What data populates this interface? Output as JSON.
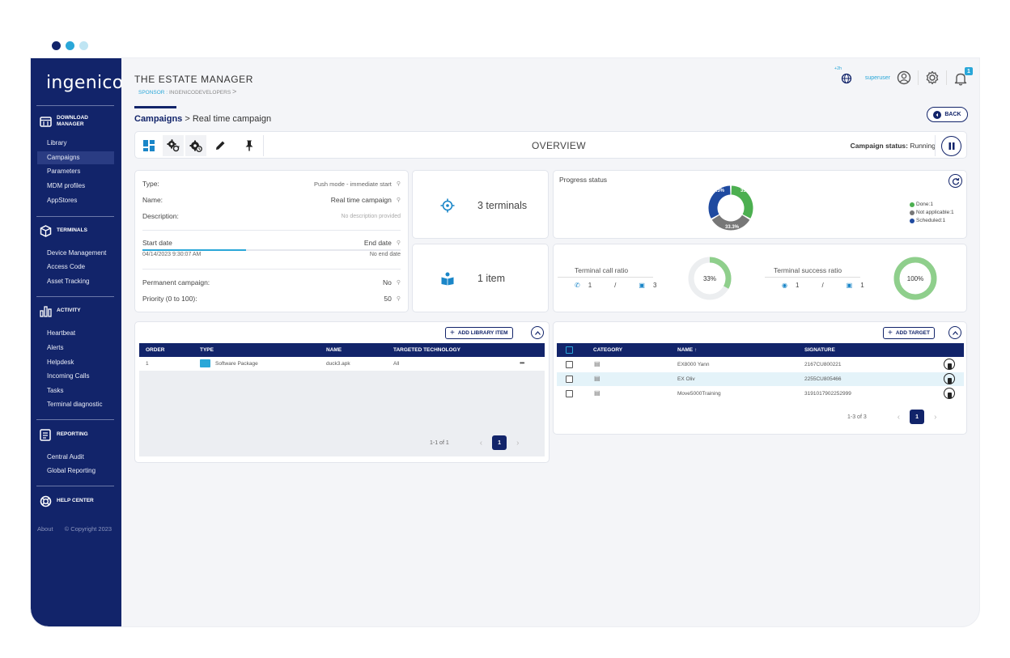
{
  "window": {
    "dots": [
      "#12246a",
      "#2aa7d8",
      "#bfe5f3"
    ]
  },
  "sidebar": {
    "logo": "ingenico",
    "sections": [
      {
        "title": "DOWNLOAD MANAGER",
        "icon": "download-manager-icon",
        "items": [
          "Library",
          "Campaigns",
          "Parameters",
          "MDM profiles",
          "AppStores"
        ],
        "active": "Campaigns"
      },
      {
        "title": "TERMINALS",
        "icon": "cube-icon",
        "items": [
          "Device Management",
          "Access Code",
          "Asset Tracking"
        ]
      },
      {
        "title": "ACTIVITY",
        "icon": "bar-chart-icon",
        "items": [
          "Heartbeat",
          "Alerts",
          "Helpdesk",
          "Incoming Calls",
          "Tasks",
          "Terminal diagnostic"
        ]
      },
      {
        "title": "REPORTING",
        "icon": "report-icon",
        "items": [
          "Central Audit",
          "Global Reporting"
        ]
      },
      {
        "title": "HELP CENTER",
        "icon": "lifebuoy-icon",
        "items": []
      }
    ],
    "footer": {
      "about": "About",
      "copyright": "© Copyright 2023"
    }
  },
  "header": {
    "title": "THE ESTATE MANAGER",
    "sponsor_label": "SPONSOR :",
    "sponsor_value": "INGENICODEVELOPERS",
    "sponsor_chevron": ">",
    "timezone": "+2h",
    "user": "superuser",
    "notification_count": "1"
  },
  "breadcrumb": {
    "root": "Campaigns",
    "sep": ">",
    "current": "Real time campaign"
  },
  "back_label": "BACK",
  "toolbar": {
    "overview": "OVERVIEW",
    "status_label": "Campaign status:",
    "status_value": "Running"
  },
  "details": {
    "type_label": "Type:",
    "type_value": "Push mode - immediate start",
    "name_label": "Name:",
    "name_value": "Real time campaign",
    "desc_label": "Description:",
    "desc_value": "No description provided",
    "start_label": "Start date",
    "start_value": "04/14/2023 9:30:07 AM",
    "end_label": "End date",
    "end_value": "No end date",
    "perm_label": "Permanent campaign:",
    "perm_value": "No",
    "prio_label": "Priority (0 to 100):",
    "prio_value": "50",
    "date_progress": 0.4
  },
  "terminals_count": "3 terminals",
  "items_count": "1 item",
  "progress": {
    "title": "Progress status",
    "labels": [
      "33.3%",
      "33.3%",
      "33.3%"
    ],
    "legend": [
      {
        "label": "Done:1",
        "color": "#4caf50"
      },
      {
        "label": "Not applicable:1",
        "color": "#777777"
      },
      {
        "label": "Scheduled:1",
        "color": "#1f4aa0"
      }
    ]
  },
  "call_ratio": {
    "title": "Terminal call ratio",
    "calls": "1",
    "sep": "/",
    "terminals": "3",
    "percent": "33%",
    "fraction": 0.33
  },
  "success_ratio": {
    "title": "Terminal success ratio",
    "success": "1",
    "sep": "/",
    "terminals": "1",
    "percent": "100%",
    "fraction": 1.0
  },
  "library": {
    "add_label": "ADD LIBRARY ITEM",
    "columns": [
      "ORDER",
      "TYPE",
      "NAME",
      "TARGETED TECHNOLOGY"
    ],
    "rows": [
      {
        "order": "1",
        "type": "Software Package",
        "name": "duck3.apk",
        "tech": "All",
        "more": "•••"
      }
    ],
    "pager_info": "1-1 of 1",
    "page": "1",
    "prev": "‹",
    "next": "›"
  },
  "targets": {
    "add_label": "ADD TARGET",
    "columns": [
      "CATEGORY",
      "NAME ↑",
      "SIGNATURE"
    ],
    "rows": [
      {
        "name": "EX8000 Yann",
        "signature": "2167CU800221"
      },
      {
        "name": "EX Oliv",
        "signature": "2255CU805466"
      },
      {
        "name": "Move5000Training",
        "signature": "3191017902252999"
      }
    ],
    "pager_info": "1-3 of 3",
    "page": "1",
    "prev": "‹",
    "next": "›"
  }
}
